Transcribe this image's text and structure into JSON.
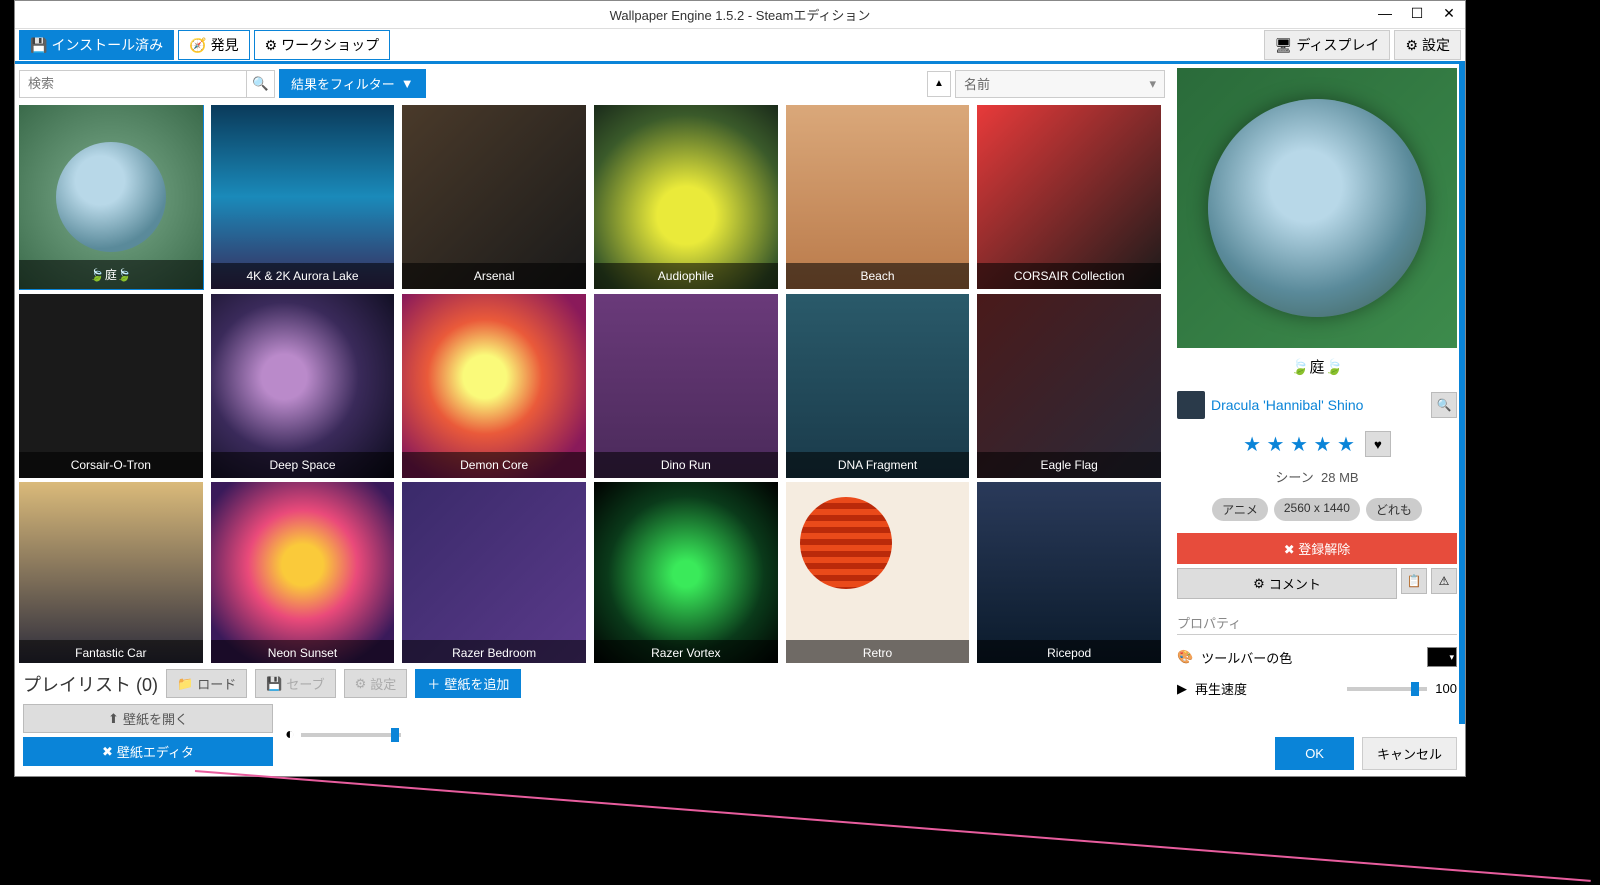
{
  "window": {
    "title": "Wallpaper Engine 1.5.2 - Steamエディション"
  },
  "toolbar": {
    "installed": "インストール済み",
    "discover": "発見",
    "workshop": "ワークショップ",
    "displays": "ディスプレイ",
    "settings": "設定"
  },
  "search": {
    "placeholder": "検索",
    "filter": "結果をフィルター",
    "sort": "名前"
  },
  "tiles": [
    {
      "label": "🍃庭🍃",
      "selected": true
    },
    {
      "label": "4K & 2K Aurora Lake"
    },
    {
      "label": "Arsenal"
    },
    {
      "label": "Audiophile"
    },
    {
      "label": "Beach"
    },
    {
      "label": "CORSAIR Collection"
    },
    {
      "label": "Corsair-O-Tron"
    },
    {
      "label": "Deep Space"
    },
    {
      "label": "Demon Core"
    },
    {
      "label": "Dino Run"
    },
    {
      "label": "DNA Fragment"
    },
    {
      "label": "Eagle Flag"
    },
    {
      "label": "Fantastic Car"
    },
    {
      "label": "Neon Sunset"
    },
    {
      "label": "Razer Bedroom"
    },
    {
      "label": "Razer Vortex"
    },
    {
      "label": "Retro"
    },
    {
      "label": "Ricepod"
    }
  ],
  "playlist": {
    "label": "プレイリスト (0)",
    "load": "ロード",
    "save": "セーブ",
    "settings": "設定",
    "add": "壁紙を追加",
    "open": "壁紙を開く",
    "editor": "壁紙エディタ"
  },
  "detail": {
    "title": "🍃庭🍃",
    "author": "Dracula 'Hannibal' Shino",
    "rating": 5,
    "type": "シーン",
    "size": "28 MB",
    "tags": [
      "アニメ",
      "2560 x 1440",
      "どれも"
    ],
    "unsubscribe": "登録解除",
    "comment": "コメント",
    "properties_label": "プロパティ",
    "props": {
      "toolbar_color": "ツールバーの色",
      "playback_speed": "再生速度",
      "speed_value": "100"
    }
  },
  "footer": {
    "ok": "OK",
    "cancel": "キャンセル"
  }
}
